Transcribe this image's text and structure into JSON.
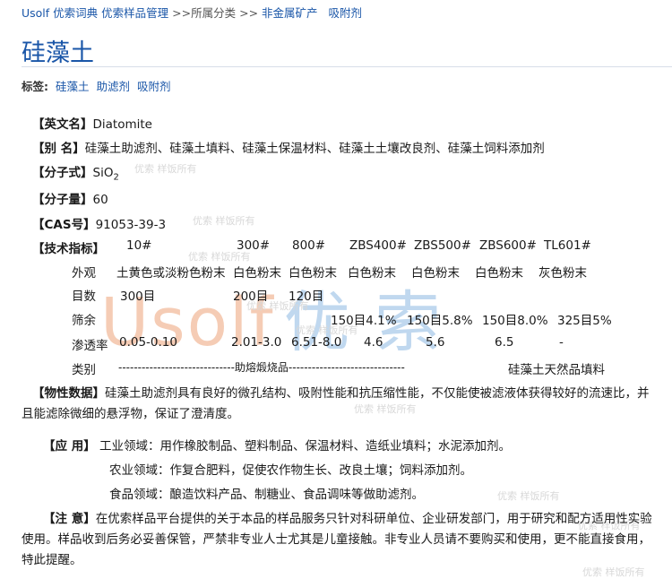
{
  "breadcrumb": {
    "site": "Usolf 优索词典",
    "section": "优索样品管理",
    "sep1": ">>所属分类",
    "sep2": ">>",
    "category": "非金属矿产",
    "sub": "吸附剂"
  },
  "title": "硅藻土",
  "tags": {
    "label": "标签:",
    "items": [
      "硅藻土",
      "助滤剂",
      "吸附剂"
    ]
  },
  "fields": {
    "english_label": "【英文名】",
    "english_value": "Diatomite",
    "alias_label": "【别  名】",
    "alias_value": "硅藻土助滤剂、硅藻土填料、硅藻土保温材料、硅藻土土壤改良剂、硅藻土饲料添加剂",
    "formula_label": "【分子式】",
    "formula_main": "SiO",
    "formula_sub": "2",
    "mw_label": "【分子量】",
    "mw_value": "60",
    "cas_label": "【CAS号】",
    "cas_value": "91053-39-3",
    "tech_label": "【技术指标】"
  },
  "tech": {
    "grades": [
      "10#",
      "300#",
      "800#",
      "ZBS400#",
      "ZBS500#",
      "ZBS600#",
      "TL601#"
    ],
    "appearance_label": "外观",
    "appearance": [
      "土黄色或淡粉色粉末",
      "白色粉末",
      "白色粉末",
      "白色粉末",
      "白色粉末",
      "白色粉末",
      "灰色粉末"
    ],
    "mesh_label": "目数",
    "mesh": [
      "300目",
      "200目",
      "120目"
    ],
    "sieve_label": "筛余",
    "sieve": [
      "150目4.1%",
      "150目5.8%",
      "150目8.0%",
      "325目5%"
    ],
    "perm_label": "渗透率",
    "perm": [
      "0.05-0.10",
      "2.01-3.0",
      "6.51-8.0",
      "4.6",
      "5.6",
      "6.5",
      "-"
    ],
    "type_label": "类别",
    "type_calcined": "------------------------------助熔煅烧品------------------------------",
    "type_natural": "硅藻土天然品填料"
  },
  "props": {
    "label": "【物性数据】",
    "text": "硅藻土助滤剂具有良好的微孔结构、吸附性能和抗压缩性能，不仅能使被滤液体获得较好的流速比，并且能滤除微细的悬浮物，保证了澄清度。"
  },
  "usage": {
    "label": "【应  用】",
    "industry": "工业领域：用作橡胶制品、塑料制品、保温材料、造纸业填料；水泥添加剂。",
    "agri": "农业领域：作复合肥料，促使农作物生长、改良土壤；饲料添加剂。",
    "food": "食品领域：酿造饮料产品、制糖业、食品调味等做助滤剂。"
  },
  "notice": {
    "label": "【注  意】",
    "text": "在优索样品平台提供的关于本品的样品服务只针对科研单位、企业研发部门，用于研究和配方适用性实验使用。样品收到后务必妥善保管，严禁非专业人士尤其是儿童接触。非专业人员请不要购买和使用，更不能直接食用，特此提醒。"
  },
  "watermark": {
    "latin": "Usolf",
    "cn": "优 索",
    "small": "优索 样饭所有"
  },
  "colors": {
    "link": "#1a56a8",
    "watermark_latin": "#f4c7ad",
    "watermark_cn": "#bad4ee"
  }
}
